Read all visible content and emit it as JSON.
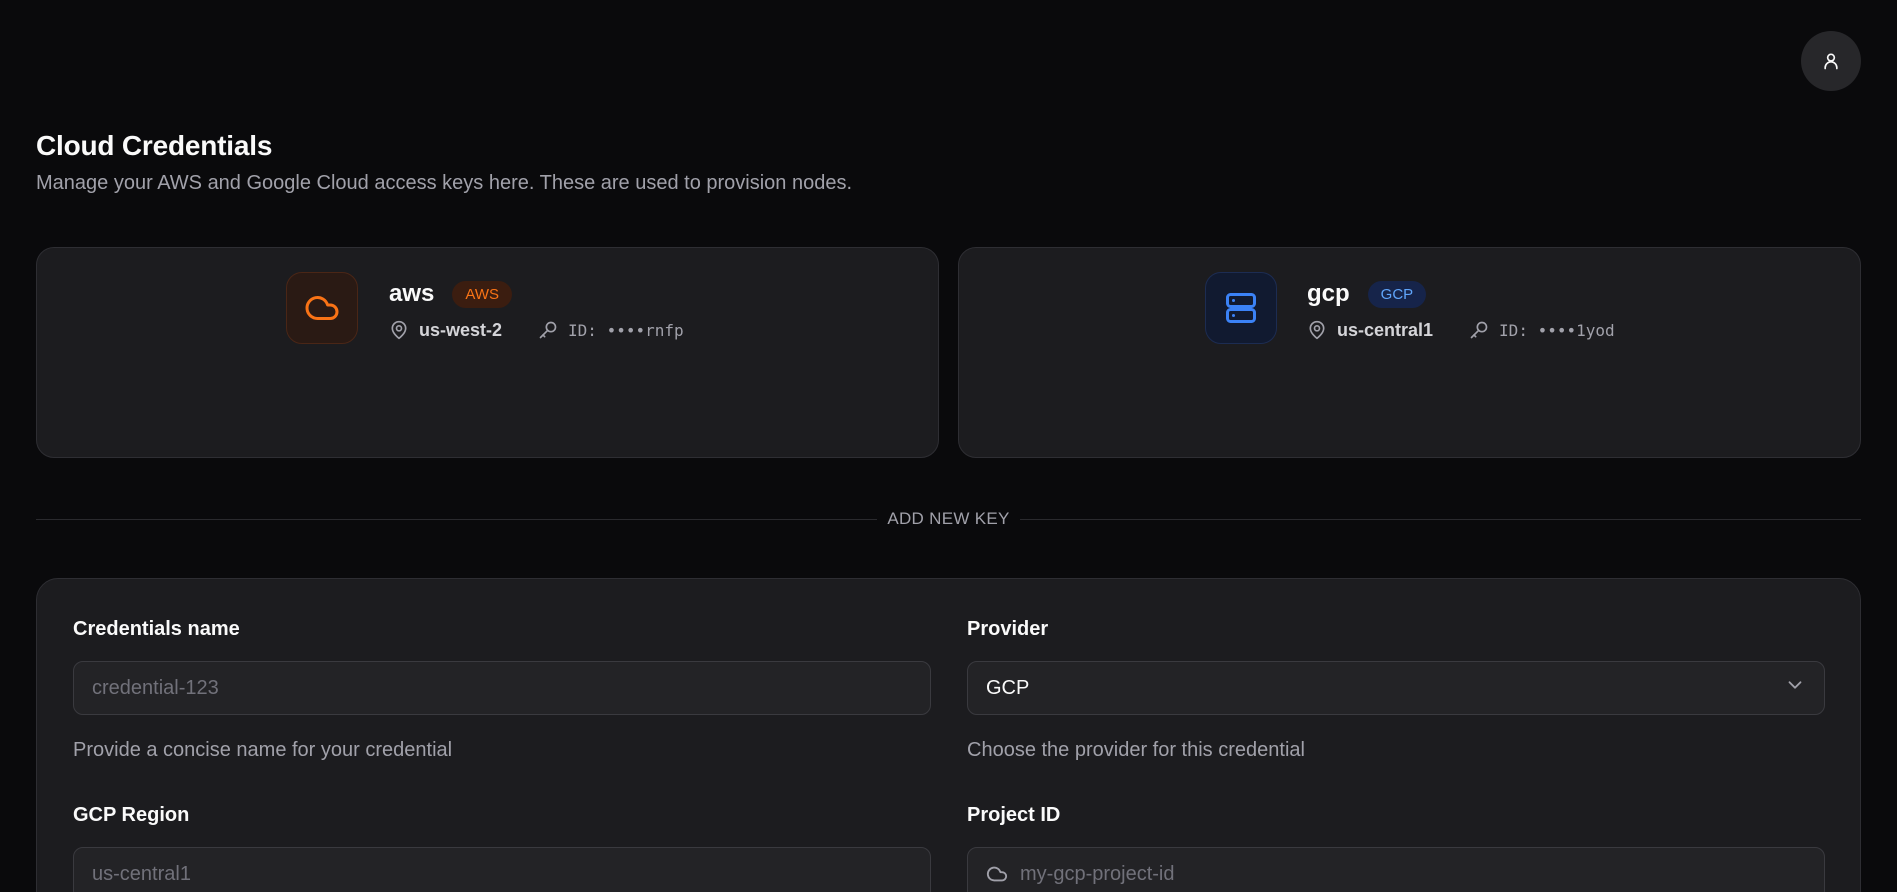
{
  "header": {
    "title": "Cloud Credentials",
    "subtitle": "Manage your AWS and Google Cloud access keys here. These are used to provision nodes."
  },
  "user_menu": {
    "icon": "user-icon"
  },
  "credentials": [
    {
      "name": "aws",
      "badge": "AWS",
      "region": "us-west-2",
      "key_id": "ID: ••••rnfp",
      "icon": "cloud-icon",
      "accent": "#f97316"
    },
    {
      "name": "gcp",
      "badge": "GCP",
      "region": "us-central1",
      "key_id": "ID: ••••1yod",
      "icon": "server-icon",
      "accent": "#3b82f6"
    }
  ],
  "divider": {
    "label": "ADD NEW KEY"
  },
  "form": {
    "credentials_name": {
      "label": "Credentials name",
      "placeholder": "credential-123",
      "help": "Provide a concise name for your credential"
    },
    "provider": {
      "label": "Provider",
      "value": "GCP",
      "help": "Choose the provider for this credential"
    },
    "region": {
      "label": "GCP Region",
      "placeholder": "us-central1"
    },
    "project_id": {
      "label": "Project ID",
      "placeholder": "my-gcp-project-id",
      "icon": "cloud-icon"
    }
  }
}
